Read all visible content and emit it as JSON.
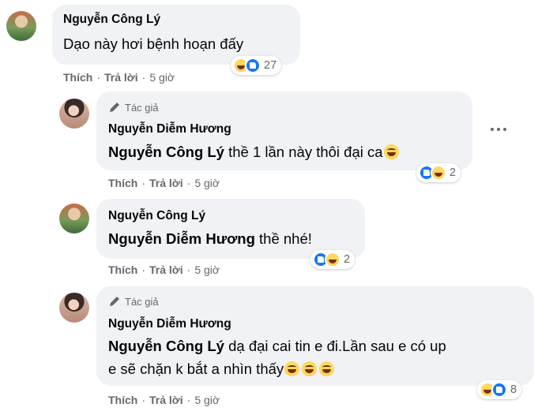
{
  "actions": {
    "like": "Thích",
    "reply": "Trả lời",
    "separator": "·",
    "time": "5 giờ"
  },
  "author_badge": "Tác giả",
  "comments": [
    {
      "name": "Nguyễn Công Lý",
      "text": "Dạo này hơi bệnh hoạn đấy",
      "reactions": [
        "haha",
        "like"
      ],
      "reaction_count": "27"
    },
    {
      "author_badge": true,
      "name": "Nguyễn Diễm Hương",
      "mention": "Nguyễn Công Lý",
      "text": " thề 1 lần này thôi đại ca",
      "emoji_count": 1,
      "reactions": [
        "like",
        "haha"
      ],
      "reaction_count": "2"
    },
    {
      "name": "Nguyễn Công Lý",
      "mention": "Nguyễn Diễm Hương",
      "text": " thề nhé!",
      "reactions": [
        "like",
        "haha"
      ],
      "reaction_count": "2"
    },
    {
      "author_badge": true,
      "name": "Nguyễn Diễm Hương",
      "mention": "Nguyễn Công Lý",
      "text": " dạ đại cai tin e đi.Lần sau e có up",
      "text_line2": "e sẽ chặn k bắt a nhìn thấy",
      "emoji_count": 3,
      "reactions": [
        "haha",
        "like"
      ],
      "reaction_count": "8"
    }
  ],
  "icons": {
    "pencil": "pencil-icon",
    "more": "more-options-icon",
    "like": "like-reaction-icon",
    "haha": "haha-reaction-icon",
    "emoji": "grinning-emoji-icon"
  },
  "colors": {
    "bubble": "#f0f2f5",
    "secondary_text": "#65676b",
    "like_blue": "#1877f2"
  }
}
